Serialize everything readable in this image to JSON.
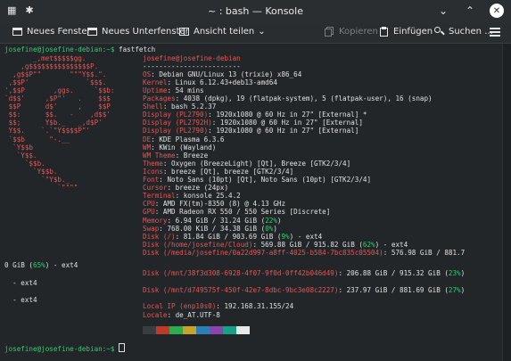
{
  "window": {
    "title": "~ : bash — Konsole"
  },
  "toolbar": {
    "new_window": "Neues Fenster",
    "new_tab": "Neues Unterfenster",
    "split_view": "Ansicht teilen",
    "copy": "Kopieren",
    "paste": "Einfügen",
    "search": "Suchen ..."
  },
  "terminal": {
    "prompt": "josefine@josefine-debian:~$",
    "command": "fastfetch",
    "logo": [
      "       _,met$$$$$gg.",
      "    ,g$$$$$$$$$$$$$$$P.",
      "  ,g$$P\"\"       \"\"\"Y$$.\".",
      " ,$$P'              `$$$.",
      "',$$P       ,ggs.     `$$b:",
      "`d$$'     ,$P\"'   .    $$$",
      " $$P      d$'     ,    $$P",
      " $$:      $$.   -    ,d$$'",
      " $$;      Y$b._   _,d$P'",
      " Y$$.    `.`\"Y$$$$P\"'",
      " `$$b      \"-.__",
      "  `Y$$b",
      "   `Y$$.",
      "     `$$b.",
      "       `Y$$b.",
      "         `\"Y$b._",
      "             `\"\"\"\""
    ],
    "user_host": "josefine@josefine-debian",
    "separator": "------------------------",
    "info": [
      {
        "key": "OS",
        "value": "Debian GNU/Linux 13 (trixie) x86_64"
      },
      {
        "key": "Kernel",
        "value": "Linux 6.12.43+deb13-amd64"
      },
      {
        "key": "Uptime",
        "value": "54 mins"
      },
      {
        "key": "Packages",
        "value": "4038 (dpkg), 19 (flatpak-system), 5 (flatpak-user), 16 (snap)"
      },
      {
        "key": "Shell",
        "value": "bash 5.2.37"
      },
      {
        "key": "Display (PL2790)",
        "value": "1920x1080 @ 60 Hz in 27\" [External] *"
      },
      {
        "key": "Display (PL2792H)",
        "value": "1920x1080 @ 60 Hz in 27\" [External]"
      },
      {
        "key": "Display (PL2790)",
        "value": "1920x1080 @ 60 Hz in 27\" [External]"
      },
      {
        "key": "DE",
        "value": "KDE Plasma 6.3.6"
      },
      {
        "key": "WM",
        "value": "KWin (Wayland)"
      },
      {
        "key": "WM Theme",
        "value": "Breeze"
      },
      {
        "key": "Theme",
        "value": "Oxygen (BreezeLight) [Qt], Breeze [GTK2/3/4]"
      },
      {
        "key": "Icons",
        "value": "breeze [Qt], breeze [GTK2/3/4]"
      },
      {
        "key": "Font",
        "value": "Noto Sans (10pt) [Qt], Noto Sans (10pt) [GTK2/3/4]"
      },
      {
        "key": "Cursor",
        "value": "breeze (24px)"
      },
      {
        "key": "Terminal",
        "value": "konsole 25.4.2"
      },
      {
        "key": "CPU",
        "value": "AMD FX(tm)-8350 (8) @ 4.13 GHz"
      },
      {
        "key": "GPU",
        "value": "AMD Radeon RX 550 / 550 Series [Discrete]"
      },
      {
        "key": "Memory",
        "value_pre": "6.94 GiB / 31.24 GiB (",
        "pct": "22%",
        "value_post": ")"
      },
      {
        "key": "Swap",
        "value_pre": "768.00 KiB / 34.38 GiB (",
        "pct": "0%",
        "value_post": ")"
      },
      {
        "key": "Disk (/)",
        "value_pre": "81.84 GiB / 903.69 GiB (",
        "pct": "9%",
        "value_post": ") - ext4"
      },
      {
        "key": "Disk (/home/josefine/Cloud)",
        "value_pre": "569.88 GiB / 915.82 GiB (",
        "pct": "62%",
        "value_post": ") - ext4"
      },
      {
        "key": "Disk (/media/josefine/0a22d997-a8ff-4025-b584-7bc835c05504)",
        "value_pre": "576.98 GiB / 881.7",
        "pct": "",
        "value_post": ""
      }
    ],
    "wrap1": "0 GiB (65%) - ext4",
    "wrap1_pct": "65%",
    "wrap2": "  - ext4",
    "wrap3": "  - ext4",
    "disk_mnt1": {
      "key": "Disk (/mnt/38f3d308-6928-4f07-9f0d-0ff42b046d49)",
      "value_pre": "206.88 GiB / 915.32 GiB (",
      "pct": "23%",
      "value_post": ")"
    },
    "disk_mnt2": {
      "key": "Disk (/mnt/d749575f-450f-42e7-8dbc-9bc3e08c2227)",
      "value_pre": "237.97 GiB / 881.69 GiB (",
      "pct": "27%",
      "value_post": ")"
    },
    "local_ip": {
      "key": "Local IP (enp10s0)",
      "value": "192.168.31.155/24"
    },
    "locale": {
      "key": "Locale",
      "value": "de_AT.UTF-8"
    },
    "palette": [
      "#3a3d40",
      "#c0392b",
      "#2eab4f",
      "#c9a227",
      "#2980b9",
      "#8e44ad",
      "#16a085",
      "#e8e8e8"
    ]
  },
  "colors": {
    "key": "#e05757",
    "logo": "#e05757",
    "ok": "#2ecc71",
    "prompt": "#2ecc71"
  }
}
